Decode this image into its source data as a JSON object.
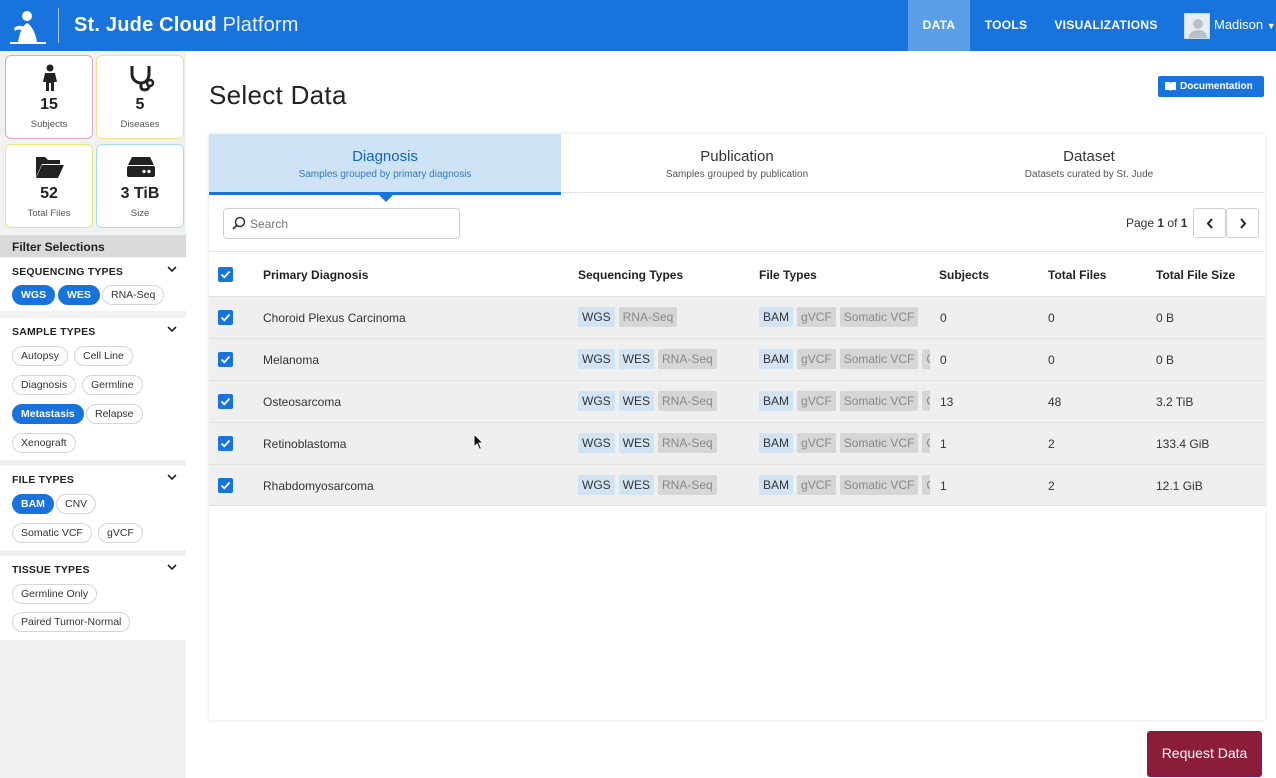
{
  "header": {
    "brand_bold": "St. Jude Cloud",
    "brand_light": " Platform",
    "nav": [
      "DATA",
      "TOOLS",
      "VISUALIZATIONS"
    ],
    "active_nav": "DATA",
    "user_name": "Madison",
    "colors": {
      "bar": "#1874dc",
      "active_tab": "#5a9ee8"
    }
  },
  "stats": [
    {
      "value": "15",
      "label": "Subjects",
      "icon": "person-icon"
    },
    {
      "value": "5",
      "label": "Diseases",
      "icon": "stethoscope-icon"
    },
    {
      "value": "52",
      "label": "Total Files",
      "icon": "folder-open-icon"
    },
    {
      "value": "3 TiB",
      "label": "Size",
      "icon": "hard-drive-icon"
    }
  ],
  "filters": {
    "title": "Filter Selections",
    "groups": [
      {
        "title": "SEQUENCING TYPES",
        "chips": [
          {
            "label": "WGS",
            "selected": true
          },
          {
            "label": "WES",
            "selected": true
          },
          {
            "label": "RNA-Seq",
            "selected": false
          }
        ]
      },
      {
        "title": "SAMPLE TYPES",
        "chips": [
          {
            "label": "Autopsy",
            "selected": false
          },
          {
            "label": "Cell Line",
            "selected": false
          },
          {
            "label": "Diagnosis",
            "selected": false
          },
          {
            "label": "Germline",
            "selected": false
          },
          {
            "label": "Metastasis",
            "selected": true
          },
          {
            "label": "Relapse",
            "selected": false
          },
          {
            "label": "Xenograft",
            "selected": false
          }
        ]
      },
      {
        "title": "FILE TYPES",
        "chips": [
          {
            "label": "BAM",
            "selected": true
          },
          {
            "label": "CNV",
            "selected": false
          },
          {
            "label": "Somatic VCF",
            "selected": false
          },
          {
            "label": "gVCF",
            "selected": false
          }
        ]
      },
      {
        "title": "TISSUE TYPES",
        "chips": [
          {
            "label": "Germline Only",
            "selected": false
          },
          {
            "label": "Paired Tumor-Normal",
            "selected": false
          }
        ]
      }
    ]
  },
  "main": {
    "title": "Select Data",
    "doc_button": "Documentation",
    "tabs": [
      {
        "label": "Diagnosis",
        "subtitle": "Samples grouped by primary diagnosis",
        "active": true
      },
      {
        "label": "Publication",
        "subtitle": "Samples grouped by publication",
        "active": false
      },
      {
        "label": "Dataset",
        "subtitle": "Datasets curated by St. Jude",
        "active": false
      }
    ],
    "search": {
      "placeholder": "Search",
      "value": ""
    },
    "pager": {
      "prefix": "Page",
      "current": "1",
      "of": "of",
      "total": "1"
    },
    "columns": [
      "Primary Diagnosis",
      "Sequencing Types",
      "File Types",
      "Subjects",
      "Total Files",
      "Total File Size"
    ],
    "rows": [
      {
        "diagnosis": "Choroid Plexus Carcinoma",
        "seq": [
          {
            "t": "WGS",
            "sel": true
          },
          {
            "t": "RNA-Seq",
            "sel": false
          }
        ],
        "files": [
          {
            "t": "BAM",
            "sel": true
          },
          {
            "t": "gVCF",
            "sel": false
          },
          {
            "t": "Somatic VCF",
            "sel": false
          }
        ],
        "subjects": "0",
        "total_files": "0",
        "size": "0 B",
        "checked": true
      },
      {
        "diagnosis": "Melanoma",
        "seq": [
          {
            "t": "WGS",
            "sel": true
          },
          {
            "t": "WES",
            "sel": true
          },
          {
            "t": "RNA-Seq",
            "sel": false
          }
        ],
        "files": [
          {
            "t": "BAM",
            "sel": true
          },
          {
            "t": "gVCF",
            "sel": false
          },
          {
            "t": "Somatic VCF",
            "sel": false
          },
          {
            "t": "CNV",
            "sel": false
          }
        ],
        "subjects": "0",
        "total_files": "0",
        "size": "0 B",
        "checked": true
      },
      {
        "diagnosis": "Osteosarcoma",
        "seq": [
          {
            "t": "WGS",
            "sel": true
          },
          {
            "t": "WES",
            "sel": true
          },
          {
            "t": "RNA-Seq",
            "sel": false
          }
        ],
        "files": [
          {
            "t": "BAM",
            "sel": true
          },
          {
            "t": "gVCF",
            "sel": false
          },
          {
            "t": "Somatic VCF",
            "sel": false
          },
          {
            "t": "CNV",
            "sel": false
          }
        ],
        "subjects": "13",
        "total_files": "48",
        "size": "3.2 TiB",
        "checked": true
      },
      {
        "diagnosis": "Retinoblastoma",
        "seq": [
          {
            "t": "WGS",
            "sel": true
          },
          {
            "t": "WES",
            "sel": true
          },
          {
            "t": "RNA-Seq",
            "sel": false
          }
        ],
        "files": [
          {
            "t": "BAM",
            "sel": true
          },
          {
            "t": "gVCF",
            "sel": false
          },
          {
            "t": "Somatic VCF",
            "sel": false
          },
          {
            "t": "CNV",
            "sel": false
          }
        ],
        "subjects": "1",
        "total_files": "2",
        "size": "133.4 GiB",
        "checked": true
      },
      {
        "diagnosis": "Rhabdomyosarcoma",
        "seq": [
          {
            "t": "WGS",
            "sel": true
          },
          {
            "t": "WES",
            "sel": true
          },
          {
            "t": "RNA-Seq",
            "sel": false
          }
        ],
        "files": [
          {
            "t": "BAM",
            "sel": true
          },
          {
            "t": "gVCF",
            "sel": false
          },
          {
            "t": "Somatic VCF",
            "sel": false
          },
          {
            "t": "CNV",
            "sel": false
          }
        ],
        "subjects": "1",
        "total_files": "2",
        "size": "12.1 GiB",
        "checked": true
      }
    ],
    "request_button": "Request Data",
    "colors": {
      "accent": "#1874dc",
      "request": "#8b1c3a",
      "tab_active_bg": "#cfe3f6"
    }
  }
}
